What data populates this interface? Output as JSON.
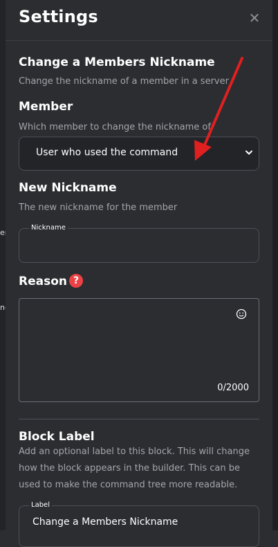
{
  "panel": {
    "title": "Settings",
    "close_symbol": "✕"
  },
  "background_fragments": [
    "er",
    "ne"
  ],
  "block": {
    "title": "Change a Members Nickname",
    "description": "Change the nickname of a member in a server"
  },
  "member": {
    "label": "Member",
    "description": "Which member to change the nickname of.",
    "selected": "User who used the command",
    "icon": "chevron-down-icon"
  },
  "new_nickname": {
    "label": "New Nickname",
    "description": "The new nickname for the member",
    "field_legend": "Nickname",
    "value": ""
  },
  "reason": {
    "label": "Reason",
    "help_symbol": "?",
    "value": "",
    "counter": "0/2000",
    "emoji_icon": "smiley-icon"
  },
  "block_label": {
    "label": "Block Label",
    "description_lines": [
      "Add an optional label to this block. This will change",
      "how the block appears in the builder. This can be",
      "used to make the command tree more readable."
    ],
    "field_legend": "Label",
    "value": "Change a Members Nickname"
  },
  "colors": {
    "panel_bg": "#2b2d31",
    "accent_red": "#ed4245",
    "arrow_red": "#e02020",
    "muted_text": "#a3a6aa"
  }
}
